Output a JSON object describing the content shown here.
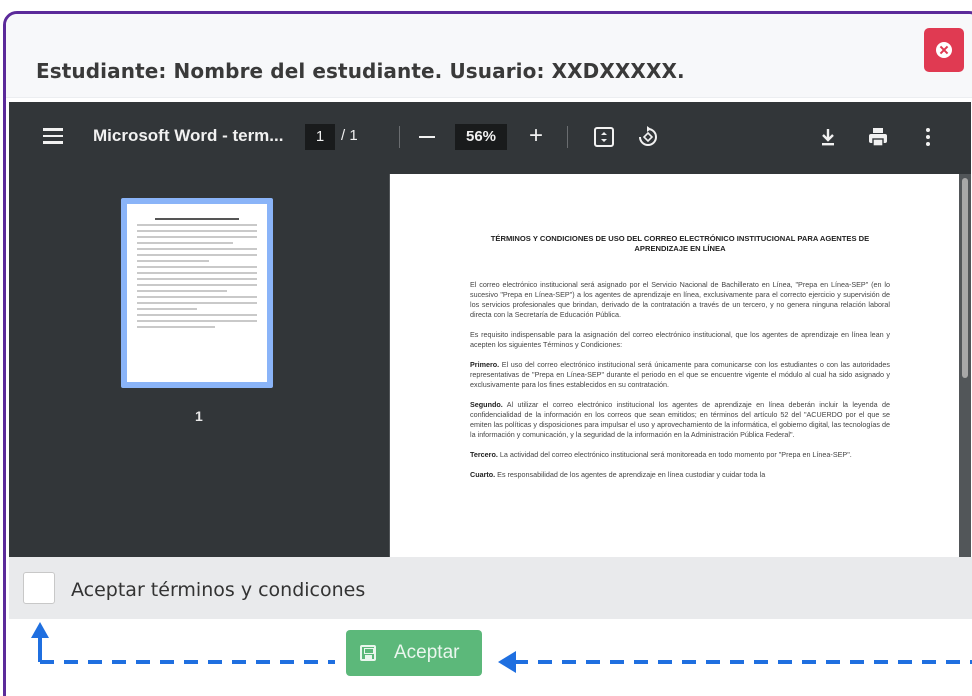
{
  "modal": {
    "title": "Estudiante: Nombre del estudiante. Usuario: XXDXXXXX."
  },
  "pdf_viewer": {
    "doc_title": "Microsoft Word - term...",
    "current_page": "1",
    "page_total": "/ 1",
    "zoom": "56%",
    "thumbnail_page_number": "1",
    "page_heading": "TÉRMINOS Y CONDICIONES DE USO DEL CORREO ELECTRÓNICO INSTITUCIONAL PARA AGENTES DE APRENDIZAJE EN LÍNEA",
    "paragraphs": [
      "El correo electrónico institucional será asignado por el Servicio Nacional de Bachillerato en Línea, \"Prepa en Línea-SEP\" (en lo sucesivo \"Prepa en Línea-SEP\") a los agentes de aprendizaje en línea, exclusivamente para el correcto ejercicio y supervisión de los servicios profesionales que brindan, derivado de la contratación a través de un tercero, y no genera ninguna relación laboral directa con la Secretaría de Educación Pública.",
      "Es requisito indispensable para la asignación del correo electrónico institucional, que los agentes de aprendizaje en línea lean y acepten los siguientes Términos y Condiciones:"
    ],
    "clauses": [
      {
        "label": "Primero.",
        "text": "El uso del correo electrónico institucional será únicamente para comunicarse con los estudiantes o con las autoridades representativas de \"Prepa en Línea-SEP\" durante el periodo en el que se encuentre vigente el módulo al cual ha sido asignado y exclusivamente para los fines establecidos en su contratación."
      },
      {
        "label": "Segundo.",
        "text": "Al utilizar el correo electrónico institucional los agentes de aprendizaje en línea deberán incluir la leyenda de confidencialidad de la información en los correos que sean emitidos; en términos del artículo 52 del \"ACUERDO por el que se emiten las políticas y disposiciones para impulsar el uso y aprovechamiento de la informática, el gobierno digital, las tecnologías de la información y comunicación, y la seguridad de la información en la Administración Pública Federal\"."
      },
      {
        "label": "Tercero.",
        "text": "La actividad del correo electrónico institucional será monitoreada en todo momento por \"Prepa en Línea-SEP\"."
      },
      {
        "label": "Cuarto.",
        "text": "Es responsabilidad de los agentes de aprendizaje en línea custodiar y cuidar toda la"
      }
    ]
  },
  "accept": {
    "checkbox_label": "Aceptar términos y condicones",
    "checked": false,
    "button_label": "Aceptar"
  },
  "colors": {
    "modal_border": "#5b2a9a",
    "close_button": "#e03a52",
    "accept_button": "#5cb87a",
    "annotation_arrow": "#1f6fe0"
  },
  "icons": [
    "close-icon",
    "menu-icon",
    "download-icon",
    "print-icon",
    "more-options-icon",
    "fit-page-icon",
    "rotate-icon",
    "save-icon"
  ]
}
